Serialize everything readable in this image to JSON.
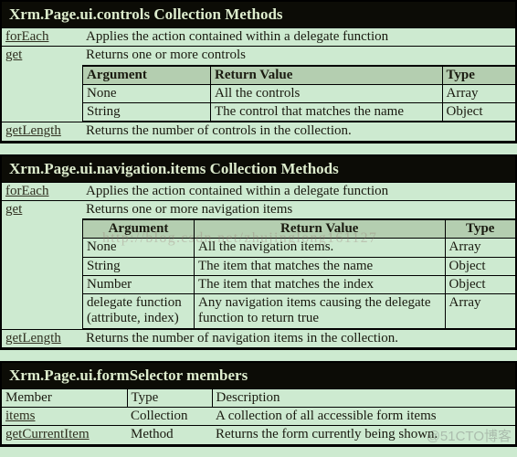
{
  "page": {
    "background_color": "#cdead0",
    "title_bar_color": "#0c0c06",
    "title_text_color": "#ddeccd",
    "header_row_color": "#b4ceb0"
  },
  "tables": [
    {
      "title": "Xrm.Page.ui.controls Collection Methods",
      "rows": [
        {
          "member": "forEach",
          "member_is_link": true,
          "description": "Applies the action contained within a delegate function"
        },
        {
          "member": "get",
          "member_is_link": true,
          "description": "Returns one or more controls",
          "nested": {
            "headers": [
              "Argument",
              "Return Value",
              "Type"
            ],
            "header_align": "left",
            "rows": [
              [
                "None",
                "All the controls",
                "Array"
              ],
              [
                "String",
                "The control that matches the name",
                "Object"
              ]
            ]
          }
        },
        {
          "member": "getLength",
          "member_is_link": true,
          "description": "Returns the number of controls in the collection."
        }
      ]
    },
    {
      "title": "Xrm.Page.ui.navigation.items Collection Methods",
      "rows": [
        {
          "member": "forEach",
          "member_is_link": true,
          "description": "Applies the action contained within a delegate function"
        },
        {
          "member": "get",
          "member_is_link": true,
          "description": "Returns one or more navigation items",
          "nested": {
            "headers": [
              "Argument",
              "Return Value",
              "Type"
            ],
            "header_align": "center",
            "rows": [
              [
                "None",
                "All the navigation items.",
                "Array"
              ],
              [
                "String",
                "The item that matches the name",
                "Object"
              ],
              [
                "Number",
                "The item that matches the index",
                "Object"
              ],
              [
                "delegate function (attribute, index)",
                "Any navigation items causing the delegate function to return true",
                "Array"
              ]
            ]
          }
        },
        {
          "member": "getLength",
          "member_is_link": true,
          "description": "Returns the number of navigation items in the collection."
        }
      ]
    },
    {
      "title": "Xrm.Page.ui.formSelector members",
      "headers": [
        "Member",
        "Type",
        "Description"
      ],
      "rows": [
        {
          "member": "items ",
          "member_is_link": true,
          "type": "Collection",
          "description": "A collection of all accessible form items"
        },
        {
          "member": "getCurrentItem",
          "member_is_link": true,
          "type": "Method",
          "description": "Returns the form currently being shown."
        }
      ]
    }
  ],
  "watermarks": {
    "url": "http://blog.csdn.net/zhujinglong161127",
    "site": "@51CTO博客"
  }
}
